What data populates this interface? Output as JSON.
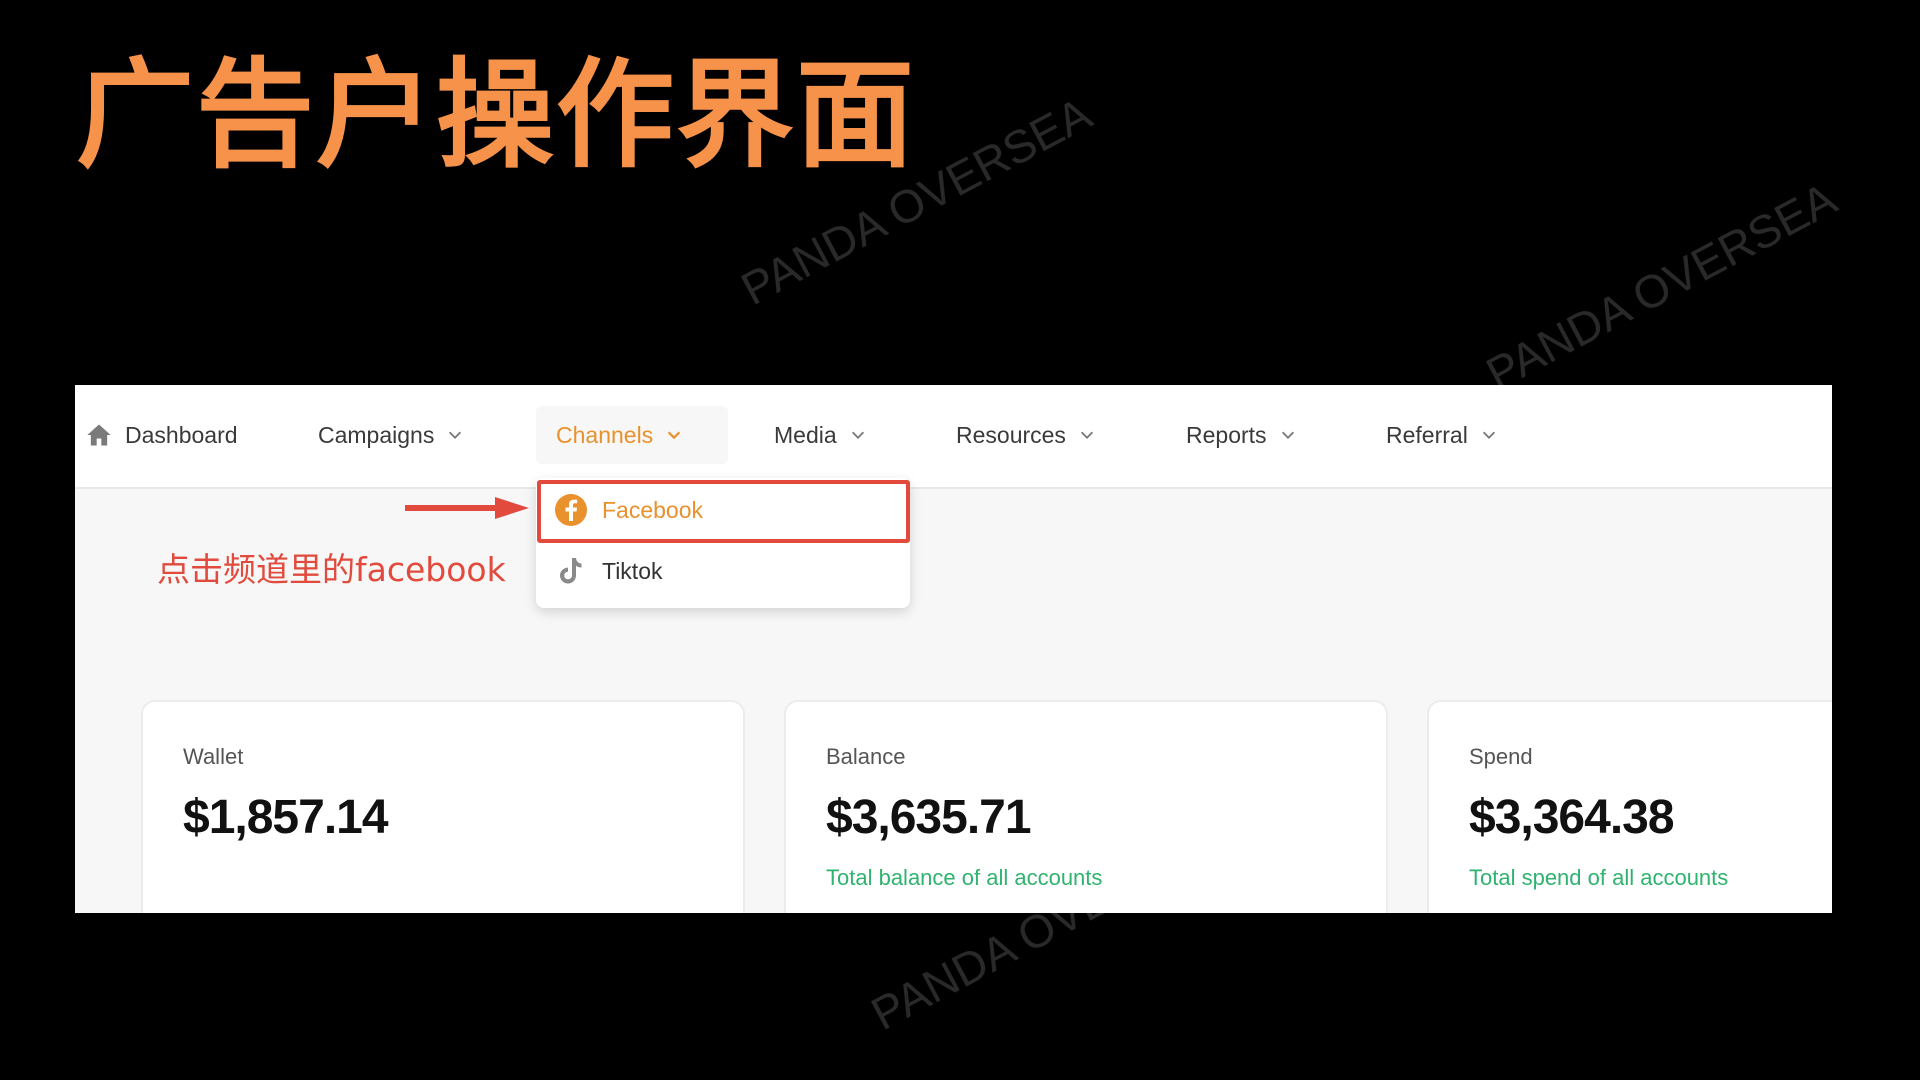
{
  "slide": {
    "title": "广告户操作界面",
    "title_color": "#f7924a",
    "watermark": "PANDA OVERSEA"
  },
  "nav": {
    "items": [
      {
        "label": "Dashboard",
        "icon": "home-icon"
      },
      {
        "label": "Campaigns",
        "icon": "chevron-down-icon"
      },
      {
        "label": "Channels",
        "icon": "chevron-down-icon",
        "active": true
      },
      {
        "label": "Media",
        "icon": "chevron-down-icon"
      },
      {
        "label": "Resources",
        "icon": "chevron-down-icon"
      },
      {
        "label": "Reports",
        "icon": "chevron-down-icon"
      },
      {
        "label": "Referral",
        "icon": "chevron-down-icon"
      }
    ],
    "active_color": "#e8912d"
  },
  "dropdown": {
    "items": [
      {
        "label": "Facebook",
        "icon": "facebook-icon",
        "highlighted": true
      },
      {
        "label": "Tiktok",
        "icon": "tiktok-icon"
      }
    ]
  },
  "annotation": {
    "text": "点击频道里的facebook",
    "color": "#e14a3c"
  },
  "cards": [
    {
      "label": "Wallet",
      "value": "$1,857.14",
      "note": ""
    },
    {
      "label": "Balance",
      "value": "$3,635.71",
      "note": "Total balance of all accounts"
    },
    {
      "label": "Spend",
      "value": "$3,364.38",
      "note": "Total spend of all accounts"
    }
  ],
  "colors": {
    "note_green": "#2fb36e"
  }
}
